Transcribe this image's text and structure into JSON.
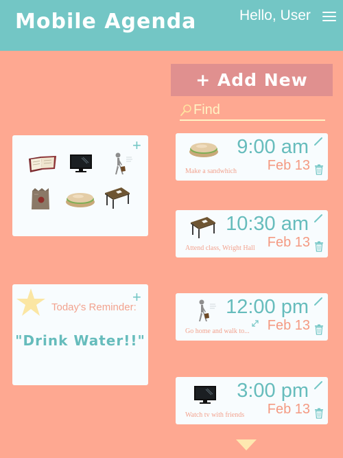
{
  "header": {
    "title": "Mobile Agenda",
    "greeting": "Hello, User",
    "menu_icon": "hamburger-menu-icon",
    "background": "#73C6C5"
  },
  "toolbar": {
    "add_new_label": "+ Add New",
    "search_placeholder": "Find",
    "search_value": ""
  },
  "icon_palette": {
    "items": [
      "book-icon",
      "tv-icon",
      "walking-person-icon",
      "paper-bag-icon",
      "sandwich-icon",
      "desk-icon"
    ]
  },
  "reminder": {
    "label": "Today's Reminder:",
    "text": "\"Drink Water!!\""
  },
  "events": [
    {
      "time": "9:00 am",
      "description": "Make a sandwhich",
      "date": "Feb 13",
      "icon": "sandwich-icon"
    },
    {
      "time": "10:30 am",
      "description": "Attend class, Wright Hall",
      "date": "Feb 13",
      "icon": "desk-icon"
    },
    {
      "time": "12:00 pm",
      "description": "Go home and walk to...",
      "date": "Feb 13",
      "icon": "walking-person-icon"
    },
    {
      "time": "3:00 pm",
      "description": "Watch tv with friends",
      "date": "Feb 13",
      "icon": "tv-icon"
    }
  ],
  "colors": {
    "background": "#FEA891",
    "accent_teal": "#73C6C5",
    "card": "#F8FCFE",
    "add_button": "#E0908F",
    "date_text": "#F49A82"
  }
}
